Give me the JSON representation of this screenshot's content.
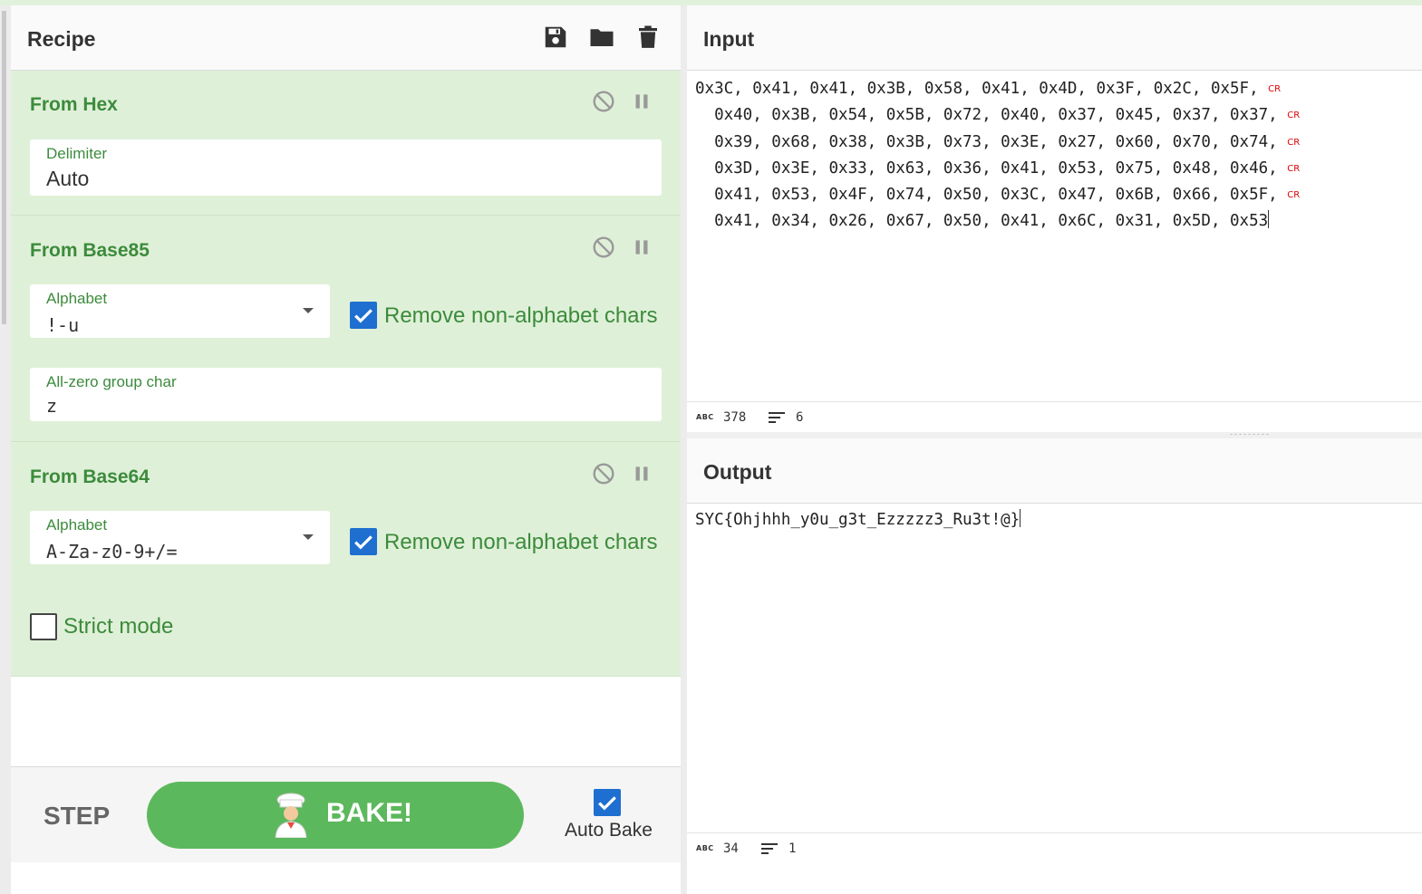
{
  "recipe": {
    "title": "Recipe",
    "header_icons": [
      "save-icon",
      "folder-icon",
      "trash-icon"
    ],
    "operations": [
      {
        "title": "From Hex",
        "delimiter_label": "Delimiter",
        "delimiter_value": "Auto"
      },
      {
        "title": "From Base85",
        "alphabet_label": "Alphabet",
        "alphabet_value": "!-u",
        "remove_non_alphabet_label": "Remove non-alphabet chars",
        "remove_non_alphabet_checked": true,
        "all_zero_label": "All-zero group char",
        "all_zero_value": "z"
      },
      {
        "title": "From Base64",
        "alphabet_label": "Alphabet",
        "alphabet_value": "A-Za-z0-9+/=",
        "remove_non_alphabet_label": "Remove non-alphabet chars",
        "remove_non_alphabet_checked": true,
        "strict_mode_label": "Strict mode",
        "strict_mode_checked": false
      }
    ],
    "controls": {
      "step_label": "STEP",
      "bake_label": "BAKE!",
      "auto_bake_label": "Auto Bake",
      "auto_bake_checked": true
    }
  },
  "input": {
    "title": "Input",
    "lines": [
      "0x3C, 0x41, 0x41, 0x3B, 0x58, 0x41, 0x4D, 0x3F, 0x2C, 0x5F, ",
      "  0x40, 0x3B, 0x54, 0x5B, 0x72, 0x40, 0x37, 0x45, 0x37, 0x37, ",
      "  0x39, 0x68, 0x38, 0x3B, 0x73, 0x3E, 0x27, 0x60, 0x70, 0x74, ",
      "  0x3D, 0x3E, 0x33, 0x63, 0x36, 0x41, 0x53, 0x75, 0x48, 0x46, ",
      "  0x41, 0x53, 0x4F, 0x74, 0x50, 0x3C, 0x47, 0x6B, 0x66, 0x5F, ",
      "  0x41, 0x34, 0x26, 0x67, 0x50, 0x41, 0x6C, 0x31, 0x5D, 0x53"
    ],
    "line_break_marker": "CR",
    "status": {
      "abc_label": "ABC",
      "chars": "378",
      "lines": "6"
    }
  },
  "output": {
    "title": "Output",
    "text": "SYC{Ohjhhh_y0u_g3t_Ezzzzz3_Ru3t!@}",
    "status": {
      "abc_label": "ABC",
      "chars": "34",
      "lines": "1"
    }
  },
  "colors": {
    "operation_bg": "#dff0d8",
    "operation_title": "#3c8b3c",
    "bake_button": "#5cb85c",
    "checkbox": "#1e6fd0",
    "cr_marker": "#dd0000"
  }
}
